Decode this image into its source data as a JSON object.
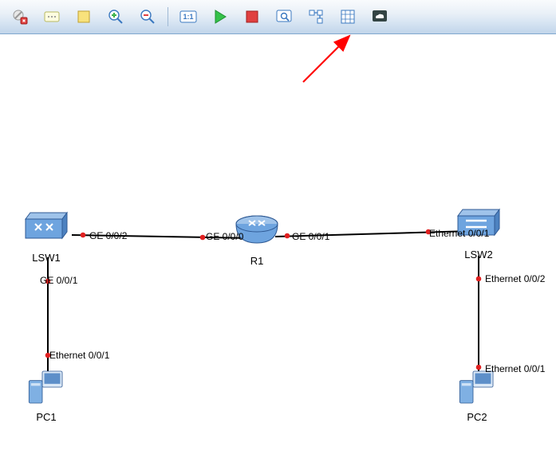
{
  "toolbar": {
    "delete": "delete",
    "annotation": "annotation",
    "note": "note",
    "zoom_in": "zoom-in",
    "zoom_out": "zoom-out",
    "fit": "1:1",
    "start": "start",
    "stop": "stop",
    "inspect": "inspect",
    "topology": "topology",
    "grid": "grid",
    "cloud": "cloud"
  },
  "devices": {
    "lsw1": "LSW1",
    "r1": "R1",
    "lsw2": "LSW2",
    "pc1": "PC1",
    "pc2": "PC2"
  },
  "ports": {
    "lsw1_ge2": "GE 0/0/2",
    "r1_ge0": "GE 0/0/0",
    "r1_ge1": "GE 0/0/1",
    "lsw2_eth1": "Ethernet 0/0/1",
    "lsw1_ge1": "GE 0/0/1",
    "lsw2_eth2": "Ethernet 0/0/2",
    "pc1_eth1": "Ethernet 0/0/1",
    "pc2_eth1": "Ethernet 0/0/1"
  }
}
